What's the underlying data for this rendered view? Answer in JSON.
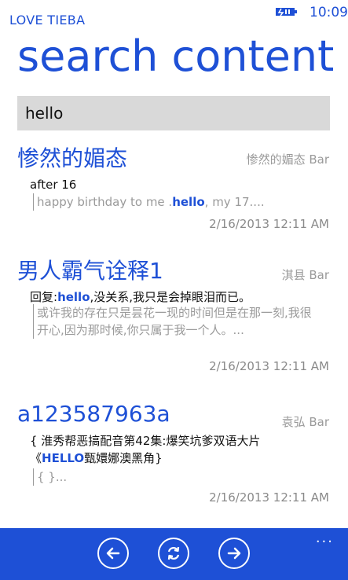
{
  "status_bar": {
    "app_name": "LOVE TIEBA",
    "time": "10:09"
  },
  "page": {
    "title": "search content"
  },
  "search": {
    "value": "hello"
  },
  "results": [
    {
      "title": "惨然的媚态",
      "bar": "惨然的媚态 Bar",
      "line1": "after 16",
      "quote_pre": "happy birthday to me .",
      "quote_hl": "hello",
      "quote_post": ", my 17....",
      "date": "2/16/2013 12:11 AM"
    },
    {
      "title": "男人霸气诠释1",
      "bar": "淇县 Bar",
      "line1_pre": "回复:",
      "line1_hl": "hello",
      "line1_post": ",没关系,我只是会掉眼泪而已。",
      "quote": "或许我的存在只是昙花一现的时间但是在那一刻,我很开心,因为那时候,你只属于我一个人。...",
      "date": "2/16/2013 12:11 AM"
    },
    {
      "title": "a123587963a",
      "bar": "袁弘 Bar",
      "line1": "{ 淮秀帮恶搞配音第42集:爆笑坑爹双语大片",
      "line2_pre": "《",
      "line2_hl": "HELLO",
      "line2_post": "甄嬛娜澳黑角}",
      "quote": "{ }...",
      "date": "2/16/2013 12:11 AM"
    }
  ],
  "app_bar": {
    "buttons": [
      "back-icon",
      "refresh-icon",
      "forward-icon"
    ],
    "more": "..."
  },
  "colors": {
    "accent": "#1e50d6",
    "search_bg": "#d9d9d9",
    "muted": "#9a9a9a"
  }
}
